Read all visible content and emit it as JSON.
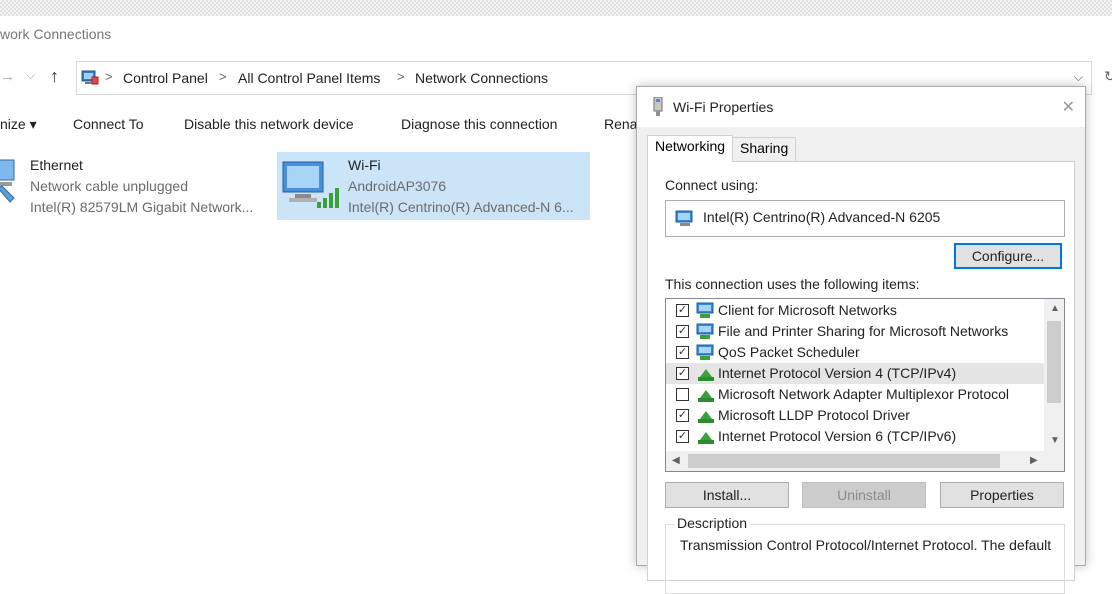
{
  "window": {
    "title": "work Connections"
  },
  "addressbar": {
    "crumbs": [
      "Control Panel",
      "All Control Panel Items",
      "Network Connections"
    ]
  },
  "commandbar": {
    "organize": "nize",
    "connect_to": "Connect To",
    "disable": "Disable this network device",
    "diagnose": "Diagnose this connection",
    "rename": "Rena"
  },
  "adapters": [
    {
      "name": "Ethernet",
      "status": "Network cable unplugged",
      "device": "Intel(R) 82579LM Gigabit Network..."
    },
    {
      "name": "Wi-Fi",
      "status": "AndroidAP3076",
      "device": "Intel(R) Centrino(R) Advanced-N 6..."
    }
  ],
  "dialog": {
    "title": "Wi-Fi Properties",
    "tabs": [
      "Networking",
      "Sharing"
    ],
    "connect_using_label": "Connect using:",
    "adapter": "Intel(R) Centrino(R) Advanced-N 6205",
    "configure": "Configure...",
    "items_label": "This connection uses the following items:",
    "items": [
      {
        "label": "Client for Microsoft Networks",
        "checked": true,
        "icon": "network-client-icon"
      },
      {
        "label": "File and Printer Sharing for Microsoft Networks",
        "checked": true,
        "icon": "network-service-icon"
      },
      {
        "label": "QoS Packet Scheduler",
        "checked": true,
        "icon": "network-service-icon"
      },
      {
        "label": "Internet Protocol Version 4 (TCP/IPv4)",
        "checked": true,
        "icon": "protocol-icon"
      },
      {
        "label": "Microsoft Network Adapter Multiplexor Protocol",
        "checked": false,
        "icon": "protocol-icon"
      },
      {
        "label": "Microsoft LLDP Protocol Driver",
        "checked": true,
        "icon": "protocol-icon"
      },
      {
        "label": "Internet Protocol Version 6 (TCP/IPv6)",
        "checked": true,
        "icon": "protocol-icon"
      }
    ],
    "install": "Install...",
    "uninstall": "Uninstall",
    "properties": "Properties",
    "description_label": "Description",
    "description_text": "Transmission Control Protocol/Internet Protocol. The default"
  }
}
